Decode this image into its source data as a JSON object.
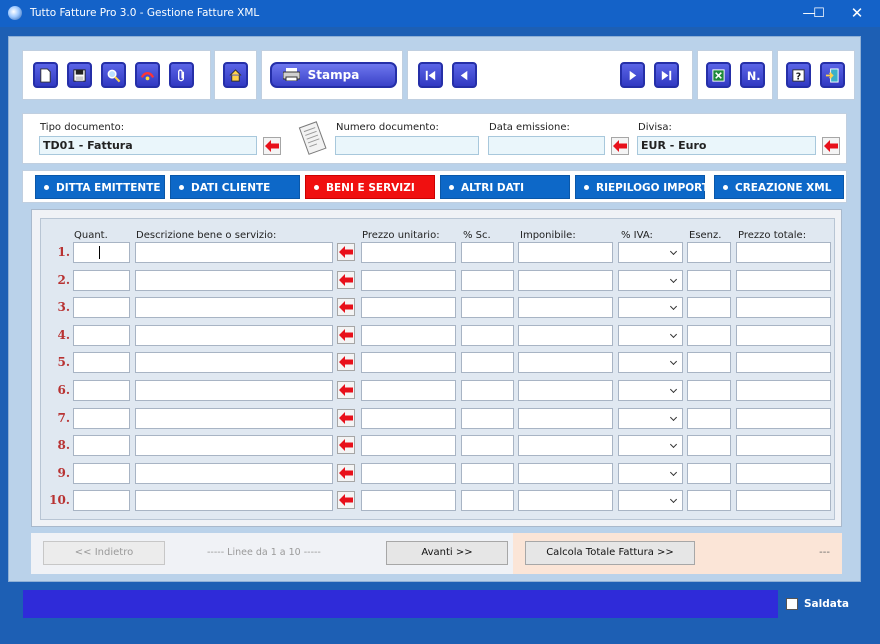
{
  "window": {
    "title": "Tutto Fatture Pro 3.0 - Gestione Fatture XML",
    "min": "—",
    "max": "☐",
    "close": "✕"
  },
  "toolbar": {
    "stampa_label": "Stampa"
  },
  "header": {
    "tipo_label": "Tipo documento:",
    "tipo_value": "TD01 - Fattura",
    "numero_label": "Numero documento:",
    "numero_value": "",
    "data_label": "Data emissione:",
    "data_value": "",
    "divisa_label": "Divisa:",
    "divisa_value": "EUR - Euro"
  },
  "tabs": [
    {
      "label": "DITTA EMITTENTE",
      "active": false
    },
    {
      "label": "DATI CLIENTE",
      "active": false
    },
    {
      "label": "BENI E SERVIZI",
      "active": true
    },
    {
      "label": "ALTRI DATI",
      "active": false
    },
    {
      "label": "RIEPILOGO IMPORTI",
      "active": false
    },
    {
      "label": "CREAZIONE XML",
      "active": false
    }
  ],
  "grid": {
    "columns": [
      "Quant.",
      "Descrizione bene o servizio:",
      "Prezzo unitario:",
      "% Sc.",
      "Imponibile:",
      "% IVA:",
      "Esenz.",
      "Prezzo totale:"
    ],
    "rows": [
      "1.",
      "2.",
      "3.",
      "4.",
      "5.",
      "6.",
      "7.",
      "8.",
      "9.",
      "10."
    ]
  },
  "nav": {
    "indietro_label": "<< Indietro",
    "linee_info": "-----  Linee da 1 a 10  -----",
    "avanti_label": "Avanti >>",
    "calcola_label": "Calcola Totale Fattura >>",
    "totale_value": "---"
  },
  "status": {
    "saldata_label": "Saldata",
    "saldata_checked": false
  },
  "colors": {
    "accent": "#1462c8",
    "tab_active": "#f01010",
    "tab": "#0d68c8",
    "status_bar": "#2f2bd9",
    "arrow": "#e8101a"
  }
}
